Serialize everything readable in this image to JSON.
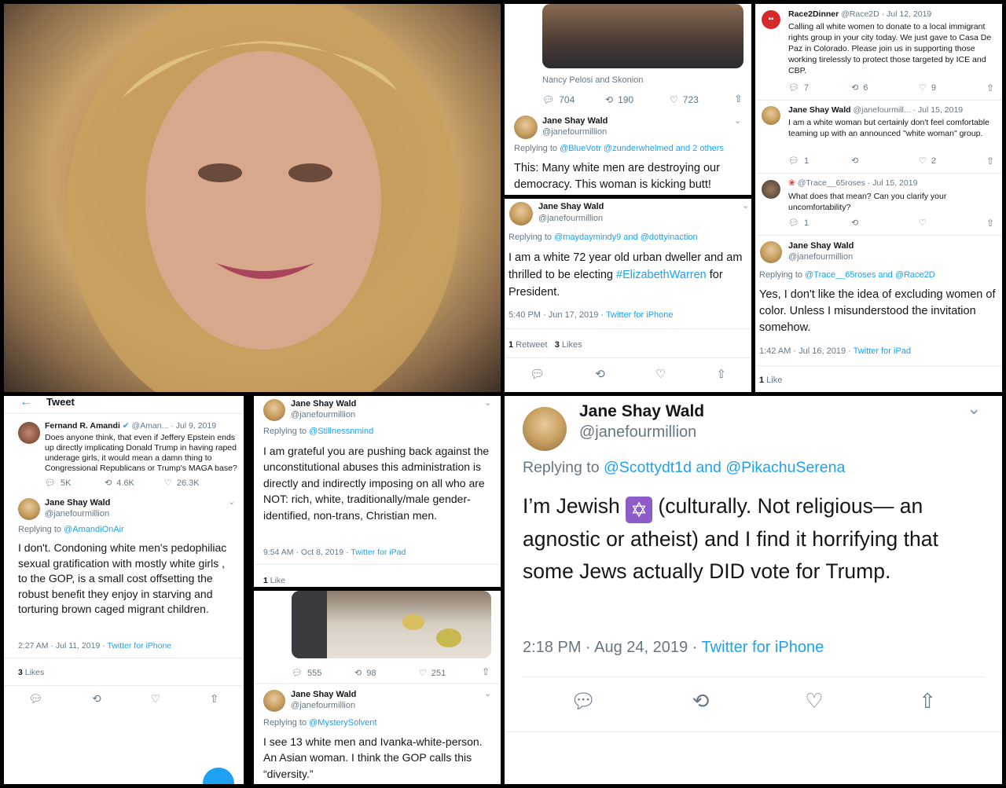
{
  "t1": {
    "top_caption": "Nancy Pelosi and Skonion",
    "reply_count": "704",
    "retweet_count": "190",
    "like_count": "723",
    "name": "Jane Shay Wald",
    "handle": "@janefourmillion",
    "replying_label": "Replying to",
    "replying_to": "@BlueVotr @zunderwhelmed and 2 others",
    "text": "This:  Many white men are destroying our democracy.  This woman is kicking butt!"
  },
  "t2": {
    "name": "Jane Shay Wald",
    "handle": "@janefourmillion",
    "replying_label": "Replying to",
    "replying_to": "@maydaymindy9 and @dottyinaction",
    "text_a": "I am a white 72 year old urban dweller and am thrilled to be electing ",
    "hashtag": "#ElizabethWarren",
    "text_b": " for President.",
    "time": "5:40 PM · Jun 17, 2019 · ",
    "source": "Twitter for iPhone",
    "retweets": "1",
    "retweets_label": " Retweet",
    "likes": "3",
    "likes_label": " Likes"
  },
  "t3": {
    "org_name": "Race2Dinner",
    "org_handle": "@Race2D · Jul 12, 2019",
    "org_text": "Calling all white women to donate to a local immigrant rights group in your city today. We just gave to Casa De Paz in Colorado. Please join us in supporting those working tirelessly to protect those targeted by ICE and CBP.",
    "org_reply": "7",
    "org_retweet": "6",
    "org_like": "9",
    "r1_name": "Jane Shay Wald",
    "r1_handle": "@janefourmill... · Jul 15, 2019",
    "r1_text": "I am a white woman but certainly don't feel comfortable teaming up with an announced \"white woman\" group.",
    "r1_reply": "1",
    "r1_like": "2",
    "r2_handle": "@Trace__65roses · Jul 15, 2019",
    "r2_text": "What does that mean? Can you clarify your uncomfortability?",
    "r2_reply": "1",
    "name": "Jane Shay Wald",
    "handle": "@janefourmillion",
    "replying_label": "Replying to",
    "replying_to": "@Trace__65roses and @Race2D",
    "text": "Yes, I don't like the idea of excluding women of color.  Unless I misunderstood the invitation somehow.",
    "time": "1:42 AM · Jul 16, 2019 · ",
    "source": "Twitter for iPad",
    "likes": "1",
    "likes_label": " Like"
  },
  "t4": {
    "header": "Tweet",
    "orig_name": "Fernand R. Amandi",
    "orig_handle": "@Aman... · Jul 9, 2019",
    "orig_text": "Does anyone think, that even if Jeffery Epstein ends up directly implicating Donald Trump in having raped underage girls, it would mean a damn thing to Congressional Republicans or Trump's MAGA base?",
    "orig_reply": "5K",
    "orig_retweet": "4.6K",
    "orig_like": "26.3K",
    "name": "Jane Shay Wald",
    "handle": "@janefourmillion",
    "replying_label": "Replying to",
    "replying_to": "@AmandiOnAir",
    "text": "I don't. Condoning white men's pedophiliac sexual gratification with mostly white girls , to the GOP, is a small cost offsetting the robust benefit they enjoy in starving and torturing brown caged migrant children.",
    "time": "2:27 AM · Jul 11, 2019 · ",
    "source": "Twitter for iPhone",
    "likes": "3",
    "likes_label": " Likes"
  },
  "t5": {
    "name": "Jane Shay Wald",
    "handle": "@janefourmillion",
    "replying_label": "Replying to",
    "replying_to": "@Stillnessnmind",
    "text": "I am grateful you are pushing back against the unconstitutional abuses this administration is directly and indirectly imposing on all who are NOT: rich, white, traditionally/male gender-identified, non-trans,  Christian men.",
    "time": "9:54 AM · Oct 8, 2019 · ",
    "source": "Twitter for iPad",
    "likes": "1",
    "likes_label": " Like"
  },
  "t6": {
    "reply_count": "555",
    "retweet_count": "98",
    "like_count": "251",
    "name": "Jane Shay Wald",
    "handle": "@janefourmillion",
    "replying_label": "Replying to",
    "replying_to": "@MysterySolvent",
    "text": "I see 13 white men and Ivanka-white-person.  An Asian woman.  I think the GOP calls this “diversity.”"
  },
  "t7": {
    "name": "Jane Shay Wald",
    "handle": "@janefourmillion",
    "replying_label": "Replying to ",
    "replying_to": "@Scottydt1d and @PikachuSerena",
    "text_a": "I’m Jewish ",
    "star": "✡",
    "text_b": " (culturally.  Not religious— an agnostic or atheist) and I find it horrifying that some Jews actually DID vote for Trump.",
    "time": "2:18 PM · Aug 24, 2019 · ",
    "source": "Twitter for iPhone"
  },
  "icons": {
    "reply": "reply-icon",
    "retweet": "retweet-icon",
    "like": "heart-icon",
    "share": "share-icon",
    "back": "back-arrow-icon"
  },
  "colors": {
    "link": "#1da1f2",
    "meta": "#657786",
    "text": "#14171a"
  }
}
